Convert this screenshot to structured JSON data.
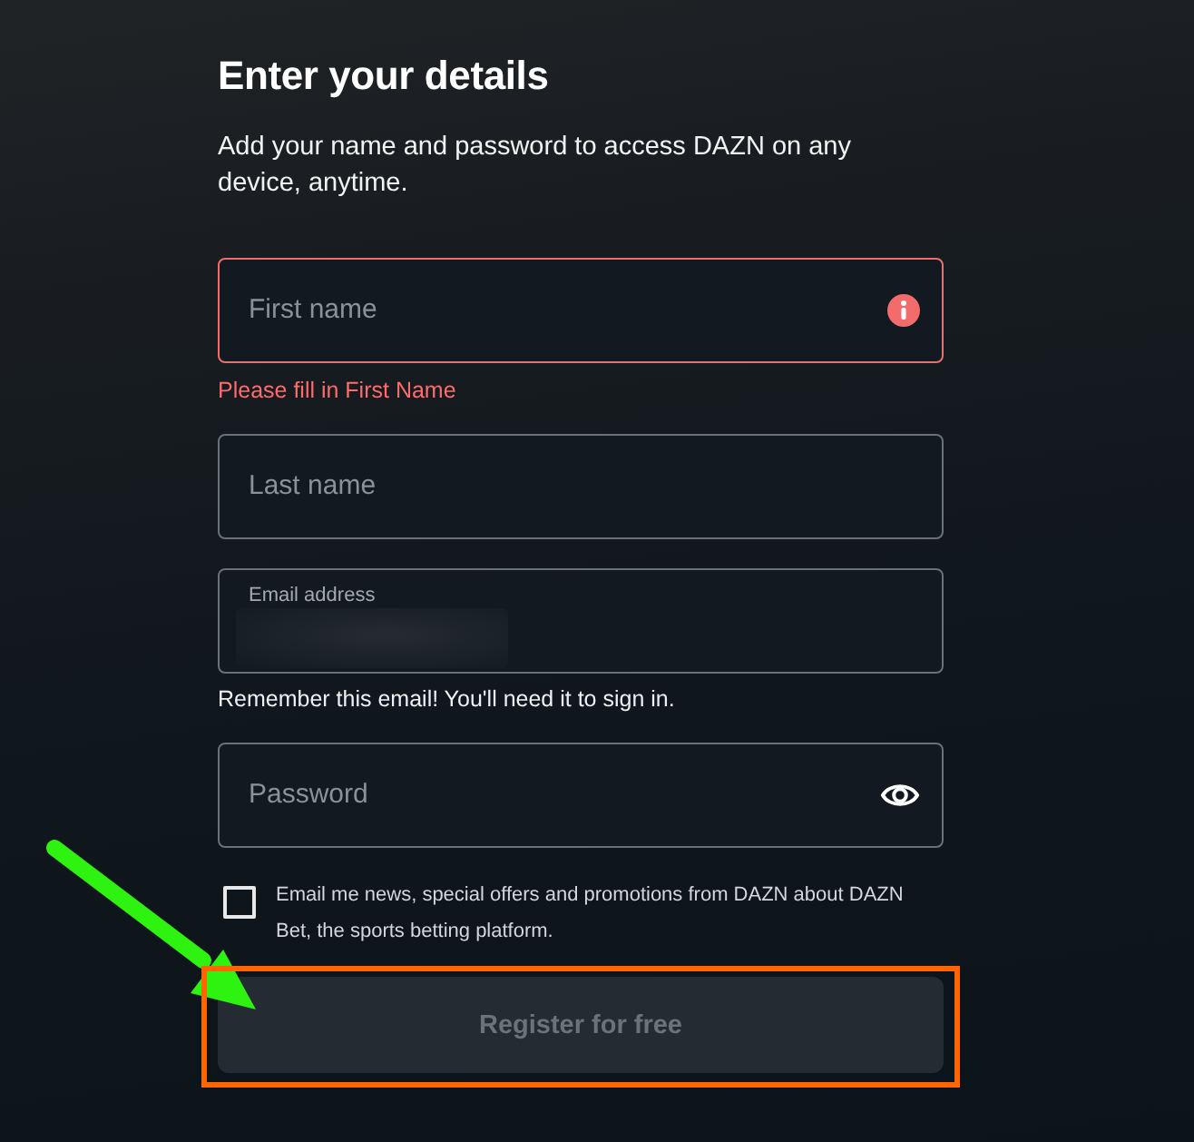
{
  "heading": "Enter your details",
  "intro": "Add your name and password to access DAZN on any device, anytime.",
  "fields": [
    {
      "kind": "text",
      "placeholder": "First name",
      "error": true,
      "error_message": "Please fill in First Name"
    },
    {
      "kind": "text",
      "placeholder": "Last name",
      "error": false
    },
    {
      "kind": "email",
      "label": "Email address",
      "redacted": true,
      "error": false,
      "helper": "Remember this email! You'll need it to sign in."
    },
    {
      "kind": "password",
      "placeholder": "Password",
      "error": false
    }
  ],
  "marketing_opt_in": {
    "label": "Email me news, special offers and promotions from DAZN about DAZN Bet, the sports betting platform.",
    "checked": false
  },
  "register_button": {
    "label": "Register for free",
    "disabled": true
  },
  "annotations": [
    {
      "kind": "arrow"
    },
    {
      "kind": "highlight_box"
    }
  ]
}
